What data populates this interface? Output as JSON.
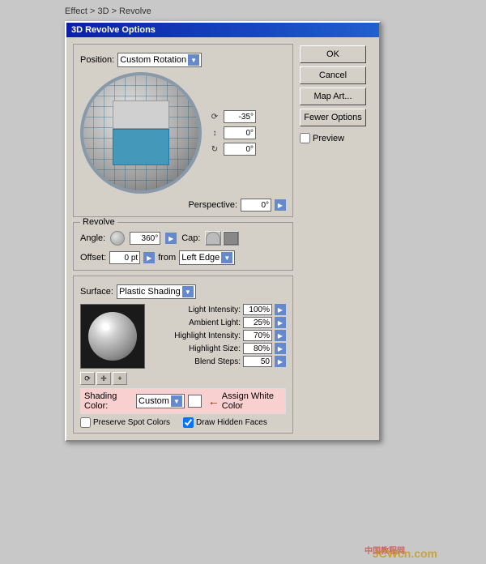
{
  "breadcrumb": "Effect > 3D > Revolve",
  "dialog": {
    "title": "3D Revolve Options",
    "position": {
      "label": "Position:",
      "value": "Custom Rotation"
    },
    "rotation": {
      "x": "-35°",
      "y": "0°",
      "z": "0°"
    },
    "perspective": {
      "label": "Perspective:",
      "value": "0°"
    },
    "revolve": {
      "label": "Revolve",
      "angle_label": "Angle:",
      "angle_value": "360°",
      "cap_label": "Cap:",
      "offset_label": "Offset:",
      "offset_value": "0 pt",
      "from_label": "from",
      "edge_value": "Left Edge"
    },
    "surface": {
      "label": "Surface:",
      "value": "Plastic Shading",
      "params": [
        {
          "label": "Light Intensity:",
          "value": "100%"
        },
        {
          "label": "Ambient Light:",
          "value": "25%"
        },
        {
          "label": "Highlight Intensity:",
          "value": "70%"
        },
        {
          "label": "Highlight Size:",
          "value": "80%"
        },
        {
          "label": "Blend Steps:",
          "value": "50"
        }
      ],
      "shading_color_label": "Shading Color:",
      "shading_color_value": "Custom",
      "assign_label": "Assign White Color"
    },
    "preserve_spot_colors": "Preserve Spot Colors",
    "draw_hidden_faces": "Draw Hidden Faces",
    "buttons": {
      "ok": "OK",
      "cancel": "Cancel",
      "map_art": "Map Art...",
      "fewer_options": "Fewer Options",
      "preview": "Preview"
    }
  }
}
